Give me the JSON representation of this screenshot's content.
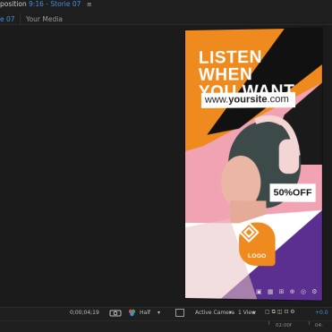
{
  "tabs": {
    "composition_prefix": "position",
    "composition_name": "9:16 - Storie 07",
    "menu_icon": "hamburger-icon",
    "active_subtab": "e 07",
    "media_subtab": "Your Media"
  },
  "poster": {
    "headline": "LISTEN WHEN\nYOU WANT",
    "site_prefix": "www.",
    "site_bold": "yoursite",
    "site_suffix": ".com",
    "discount": "50%OFF",
    "logo_text": "LOGO",
    "colors": {
      "orange": "#ef8a1e",
      "purple": "#5a2f8f",
      "pink": "#f2a3b3",
      "black": "#111111"
    }
  },
  "toolbar": {
    "zoom": "",
    "timecode": "0;00;04;19",
    "color_icon": "color-picker-icon",
    "resolution": "Half",
    "camera": "Active Camera",
    "views": "1 View",
    "exposure": "+0.0",
    "ruler_labels": [
      "02:00f",
      "04:"
    ]
  }
}
